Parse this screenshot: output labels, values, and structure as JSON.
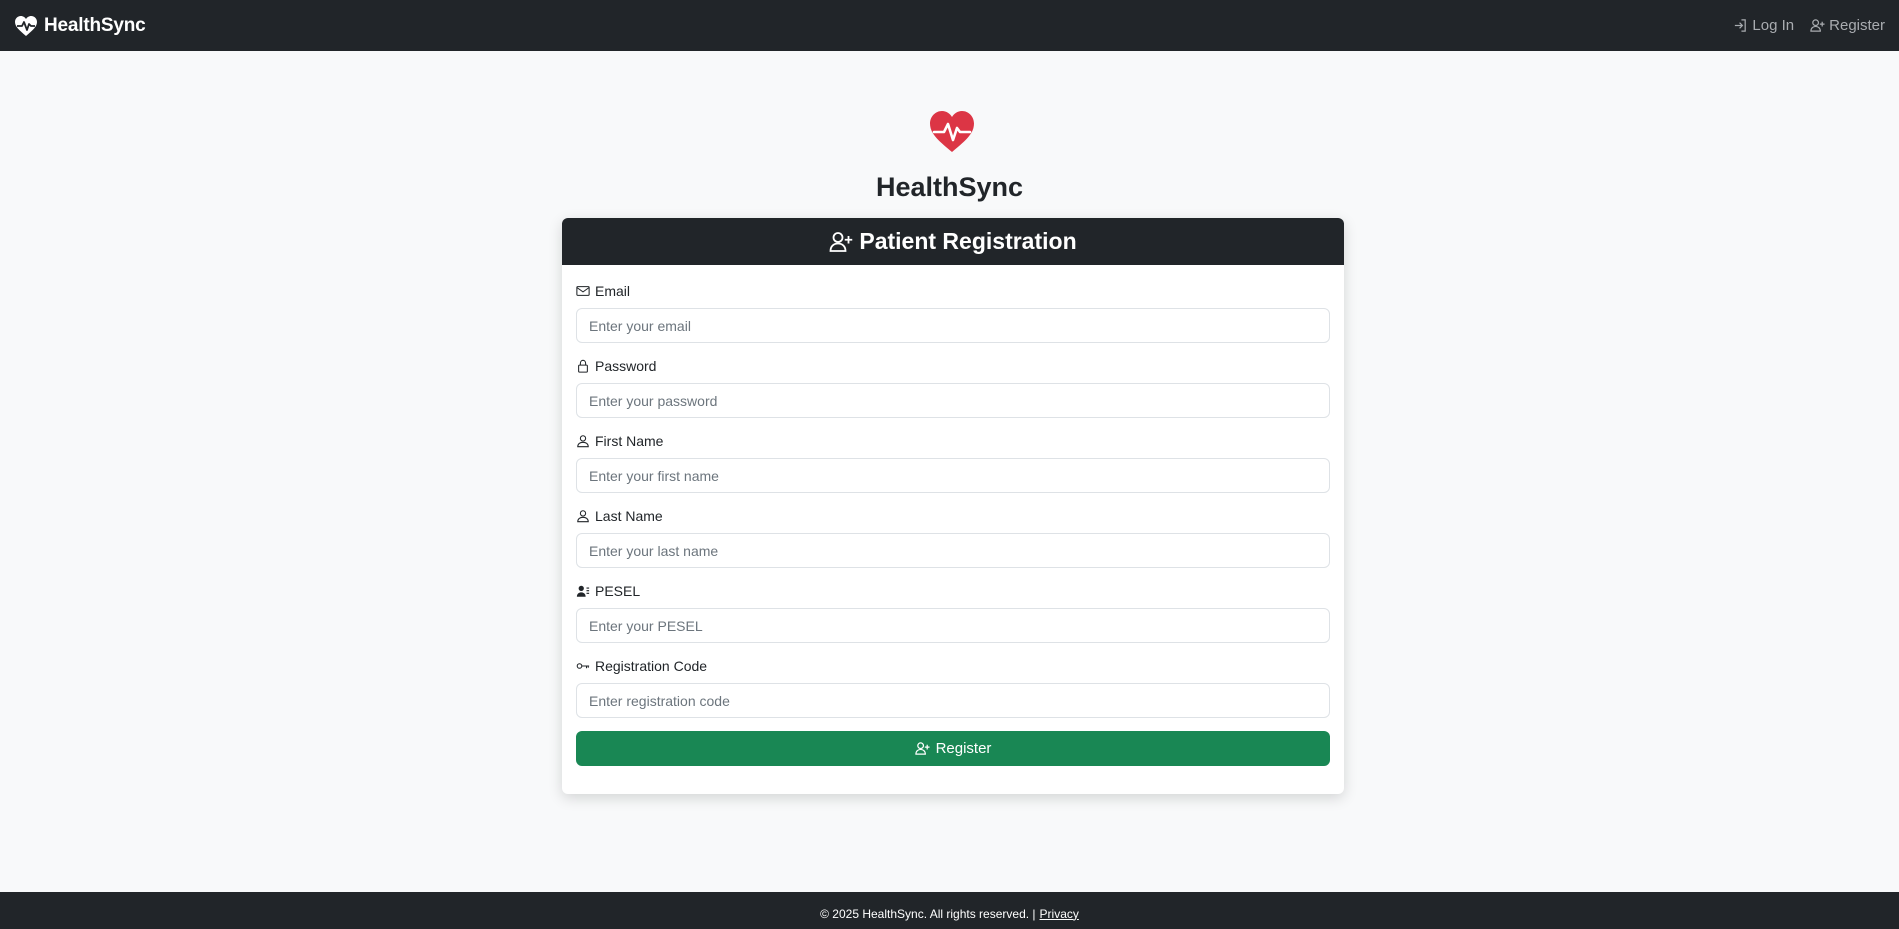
{
  "navbar": {
    "brand": "HealthSync",
    "links": [
      {
        "label": "Log In",
        "icon": "login-icon"
      },
      {
        "label": "Register",
        "icon": "person-plus-icon"
      }
    ]
  },
  "hero": {
    "title": "HealthSync",
    "icon": "heart-pulse-icon",
    "icon_color": "#dc3545"
  },
  "form": {
    "header": "Patient Registration",
    "fields": [
      {
        "label": "Email",
        "placeholder": "Enter your email",
        "icon": "envelope-icon",
        "value": ""
      },
      {
        "label": "Password",
        "placeholder": "Enter your password",
        "icon": "lock-icon",
        "value": ""
      },
      {
        "label": "First Name",
        "placeholder": "Enter your first name",
        "icon": "person-icon",
        "value": ""
      },
      {
        "label": "Last Name",
        "placeholder": "Enter your last name",
        "icon": "person-icon",
        "value": ""
      },
      {
        "label": "PESEL",
        "placeholder": "Enter your PESEL",
        "icon": "person-vcard-icon",
        "value": ""
      },
      {
        "label": "Registration Code",
        "placeholder": "Enter registration code",
        "icon": "key-icon",
        "value": ""
      }
    ],
    "submit_label": "Register",
    "submit_color": "#198754"
  },
  "footer": {
    "text": "© 2025 HealthSync. All rights reserved. |",
    "privacy_label": "Privacy"
  }
}
